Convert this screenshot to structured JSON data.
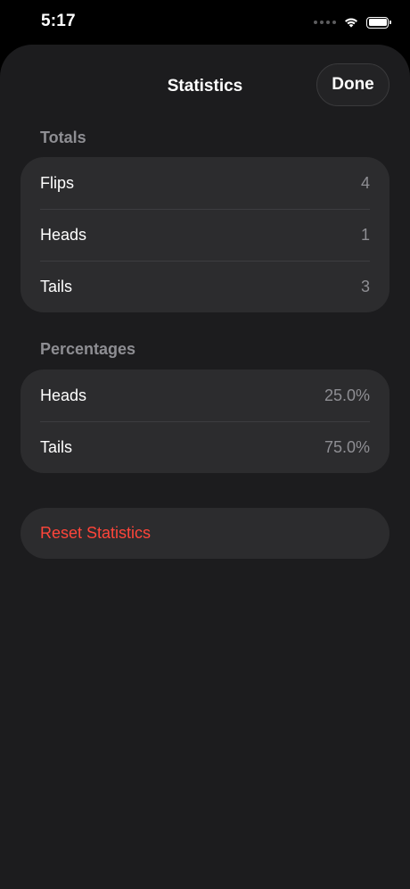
{
  "status_bar": {
    "time": "5:17"
  },
  "sheet": {
    "title": "Statistics",
    "done_label": "Done"
  },
  "totals": {
    "header": "Totals",
    "rows": [
      {
        "label": "Flips",
        "value": "4"
      },
      {
        "label": "Heads",
        "value": "1"
      },
      {
        "label": "Tails",
        "value": "3"
      }
    ]
  },
  "percentages": {
    "header": "Percentages",
    "rows": [
      {
        "label": "Heads",
        "value": "25.0%"
      },
      {
        "label": "Tails",
        "value": "75.0%"
      }
    ]
  },
  "reset_label": "Reset Statistics",
  "colors": {
    "background": "#000000",
    "sheet": "#1c1c1e",
    "group": "#2c2c2e",
    "secondary_text": "#8e8e93",
    "destructive": "#ff453a"
  },
  "icons": [
    "signal-icon",
    "wifi-icon",
    "battery-icon"
  ]
}
